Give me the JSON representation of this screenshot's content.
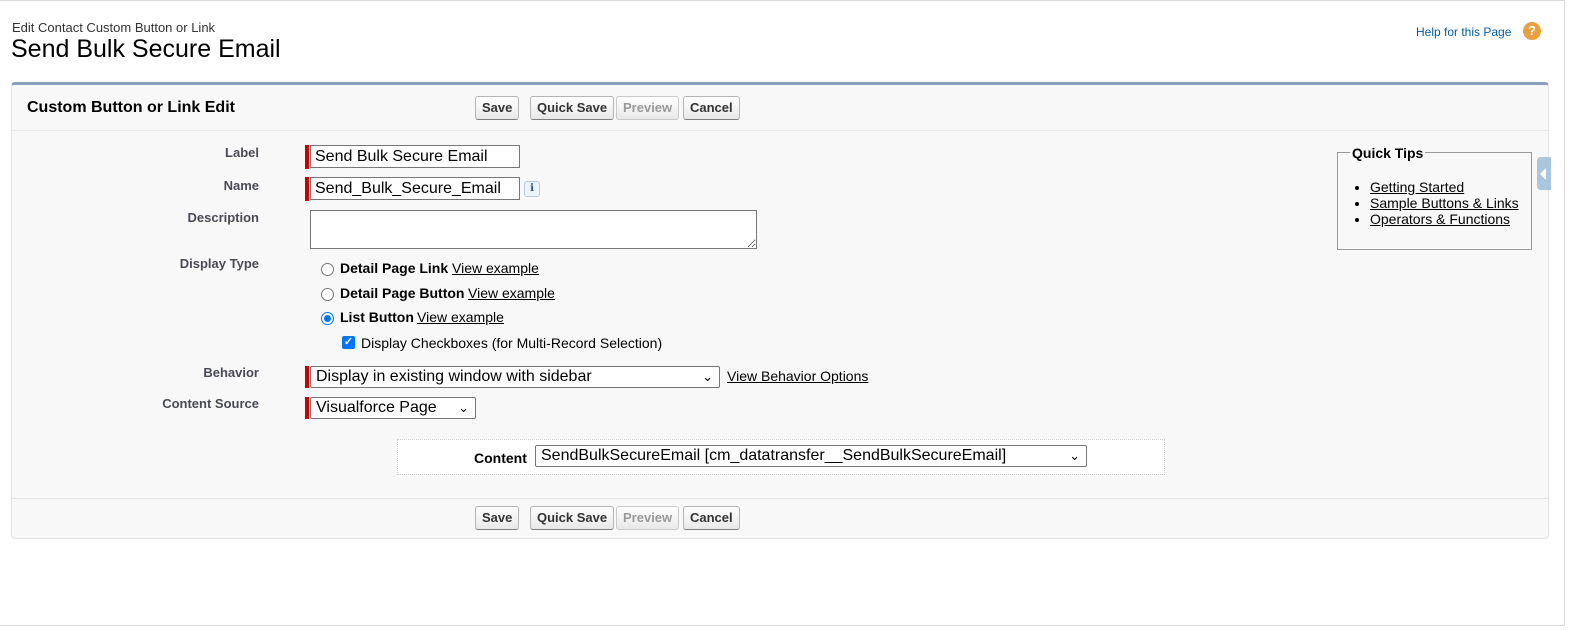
{
  "header": {
    "page_type": "Edit Contact Custom Button or Link",
    "page_title": "Send Bulk Secure Email",
    "help_link": "Help for this Page",
    "help_icon": "?"
  },
  "block": {
    "title": "Custom Button or Link Edit"
  },
  "buttons": {
    "save": "Save",
    "quick_save": "Quick Save",
    "preview": "Preview",
    "cancel": "Cancel"
  },
  "form": {
    "label": {
      "label": "Label",
      "value": "Send Bulk Secure Email"
    },
    "name": {
      "label": "Name",
      "value": "Send_Bulk_Secure_Email",
      "info_icon": "i"
    },
    "description": {
      "label": "Description",
      "value": ""
    },
    "display_type": {
      "label": "Display Type",
      "options": [
        {
          "text": "Detail Page Link",
          "link": "View example",
          "selected": false
        },
        {
          "text": "Detail Page Button",
          "link": "View example",
          "selected": false
        },
        {
          "text": "List Button",
          "link": "View example",
          "selected": true
        }
      ],
      "checkbox": {
        "text": "Display Checkboxes (for Multi-Record Selection)",
        "checked": true
      }
    },
    "behavior": {
      "label": "Behavior",
      "value": "Display in existing window with sidebar",
      "link": "View Behavior Options"
    },
    "content_source": {
      "label": "Content Source",
      "value": "Visualforce Page"
    },
    "content": {
      "label": "Content",
      "value": "SendBulkSecureEmail [cm_datatransfer__SendBulkSecureEmail]"
    }
  },
  "quick_tips": {
    "title": "Quick Tips",
    "items": [
      "Getting Started",
      "Sample Buttons & Links",
      "Operators & Functions"
    ]
  },
  "colors": {
    "required_bar": "#cc0000",
    "link_blue": "#015ba7",
    "header_border": "#8a9ebe",
    "help_icon": "#e8a13c",
    "accent_blue": "#0075ff"
  }
}
